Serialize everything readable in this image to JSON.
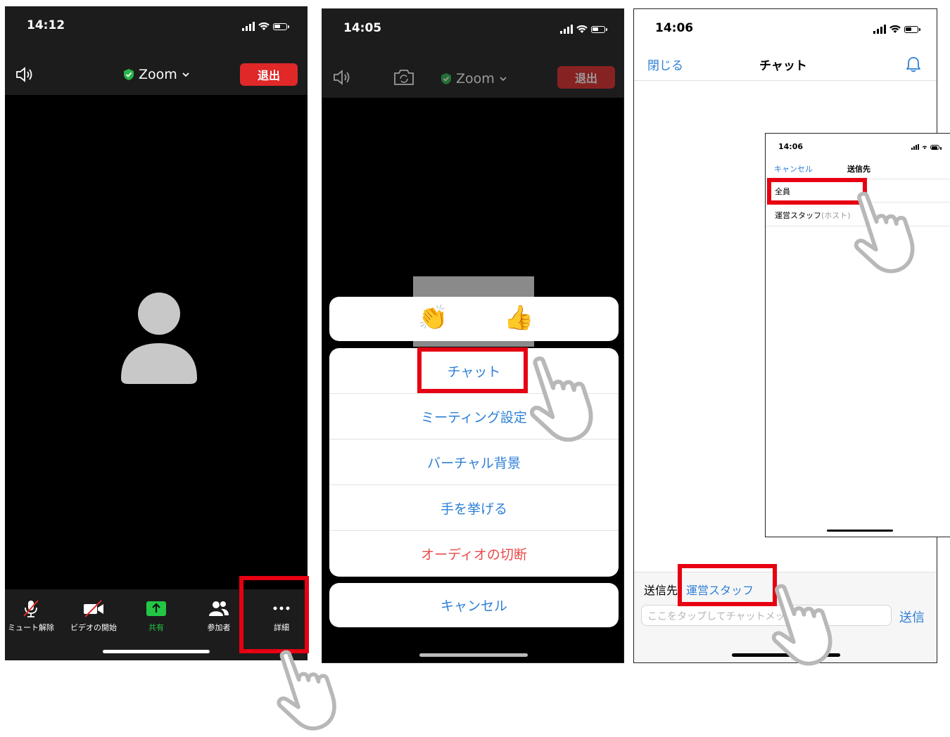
{
  "colors": {
    "zoom_red": "#e02828",
    "ios_blue": "#2e7fd6",
    "highlight_red": "#e60012",
    "shield_green": "#2bb34a",
    "share_green": "#22c744"
  },
  "screen1": {
    "time": "14:12",
    "title": "Zoom",
    "leave_label": "退出",
    "toolbar": [
      {
        "label": "ミュート解除",
        "icon": "mic-muted-icon"
      },
      {
        "label": "ビデオの開始",
        "icon": "video-off-icon"
      },
      {
        "label": "共有",
        "icon": "share-arrow-icon"
      },
      {
        "label": "参加者",
        "icon": "participants-icon"
      },
      {
        "label": "詳細",
        "icon": "more-dots-icon"
      }
    ]
  },
  "screen2": {
    "time": "14:05",
    "title": "Zoom",
    "leave_label": "退出",
    "reactions": [
      "👏",
      "👍"
    ],
    "menu": [
      {
        "label": "チャット"
      },
      {
        "label": "ミーティング設定"
      },
      {
        "label": "バーチャル背景"
      },
      {
        "label": "手を挙げる"
      },
      {
        "label": "オーディオの切断"
      }
    ],
    "cancel_label": "キャンセル"
  },
  "screen3": {
    "time": "14:06",
    "close_label": "閉じる",
    "title": "チャット",
    "send_to_label": "送信先",
    "recipient": "運営スタッフ",
    "input_placeholder": "ここをタップしてチャットメッセー…",
    "send_label": "送信"
  },
  "inset": {
    "time": "14:06",
    "cancel_label": "キャンセル",
    "title": "送信先",
    "options": [
      {
        "label": "全員"
      },
      {
        "label": "運営スタッフ",
        "suffix": "(ホスト)"
      }
    ]
  }
}
